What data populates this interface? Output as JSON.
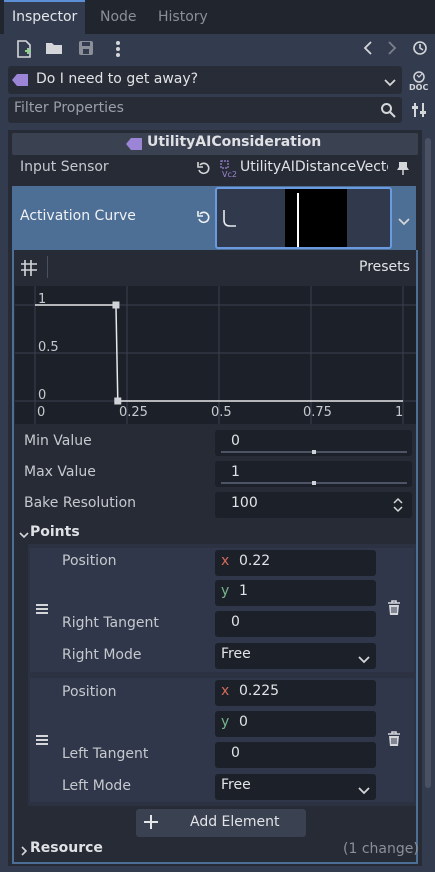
{
  "tabs": {
    "inspector": "Inspector",
    "node": "Node",
    "history": "History"
  },
  "toolbar": {
    "icons": [
      "new-resource-icon",
      "open-folder-icon",
      "save-icon",
      "more-vertical-icon",
      "back-icon",
      "forward-icon",
      "history-icon"
    ]
  },
  "resource_path": {
    "text": "Do I need to get away?",
    "doc_label": "DOC"
  },
  "filter": {
    "placeholder": "Filter Properties"
  },
  "class_header": {
    "label": "UtilityAIConsideration"
  },
  "input_sensor": {
    "label": "Input Sensor",
    "value": "UtilityAIDistanceVecto"
  },
  "activation_curve": {
    "label": "Activation Curve"
  },
  "curve_editor": {
    "presets_label": "Presets",
    "y_ticks": [
      "1",
      "0.5",
      "0"
    ],
    "x_ticks": [
      "0",
      "0.25",
      "0.5",
      "0.75",
      "1"
    ]
  },
  "chart_data": {
    "type": "line",
    "x": [
      0,
      0.22,
      0.225,
      1
    ],
    "values": [
      1,
      1,
      0,
      0
    ],
    "xlim": [
      0,
      1
    ],
    "ylim": [
      0,
      1
    ],
    "x_ticks": [
      "0",
      "0.25",
      "0.5",
      "0.75",
      "1"
    ],
    "y_ticks": [
      "1",
      "0.5",
      "0"
    ],
    "grid": true
  },
  "props": {
    "min_value": {
      "label": "Min Value",
      "value": "0",
      "slider_fraction": 0.5
    },
    "max_value": {
      "label": "Max Value",
      "value": "1",
      "slider_fraction": 0.5
    },
    "bake_resolution": {
      "label": "Bake Resolution",
      "value": "100"
    }
  },
  "points": {
    "section_label": "Points",
    "items": [
      {
        "position_label": "Position",
        "x": "0.22",
        "y": "1",
        "tangent_label": "Right Tangent",
        "tangent_value": "0",
        "mode_label": "Right Mode",
        "mode_value": "Free"
      },
      {
        "position_label": "Position",
        "x": "0.225",
        "y": "0",
        "tangent_label": "Left Tangent",
        "tangent_value": "0",
        "mode_label": "Left Mode",
        "mode_value": "Free"
      }
    ],
    "axis_x": "x",
    "axis_y": "y",
    "add_element": "Add Element"
  },
  "resource": {
    "label": "Resource",
    "changes": "(1 change)"
  },
  "colors": {
    "accent": "#5c8fd6",
    "selected_row": "#4d6e95",
    "background": "#333b4f",
    "field": "#1c2029",
    "x_axis_tag": "#d26a5a",
    "y_axis_tag": "#76b58c"
  }
}
